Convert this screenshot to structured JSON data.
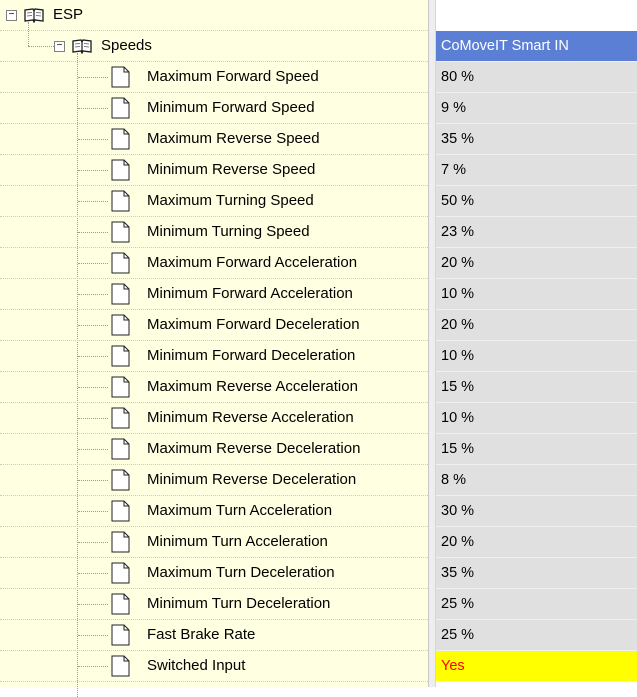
{
  "tree": {
    "root": {
      "label": "ESP",
      "expander": "−",
      "icon": "open-book-icon"
    },
    "group": {
      "label": "Speeds",
      "expander": "−",
      "icon": "open-book-icon"
    },
    "item_icon": "document-page-icon",
    "items": [
      {
        "label": "Maximum Forward Speed",
        "value": "80 %"
      },
      {
        "label": "Minimum Forward Speed",
        "value": "9 %"
      },
      {
        "label": "Maximum Reverse Speed",
        "value": "35 %"
      },
      {
        "label": "Minimum Reverse Speed",
        "value": "7 %"
      },
      {
        "label": "Maximum Turning Speed",
        "value": "50 %"
      },
      {
        "label": "Minimum Turning Speed",
        "value": "23 %"
      },
      {
        "label": "Maximum Forward Acceleration",
        "value": "20 %"
      },
      {
        "label": "Minimum Forward Acceleration",
        "value": "10 %"
      },
      {
        "label": "Maximum Forward Deceleration",
        "value": "20 %"
      },
      {
        "label": "Minimum Forward Deceleration",
        "value": "10 %"
      },
      {
        "label": "Maximum Reverse Acceleration",
        "value": "15 %"
      },
      {
        "label": "Minimum Reverse Acceleration",
        "value": "10 %"
      },
      {
        "label": "Maximum Reverse Deceleration",
        "value": "15 %"
      },
      {
        "label": "Minimum Reverse Deceleration",
        "value": "8 %"
      },
      {
        "label": "Maximum Turn Acceleration",
        "value": "30 %"
      },
      {
        "label": "Minimum Turn Acceleration",
        "value": "20 %"
      },
      {
        "label": "Maximum Turn Deceleration",
        "value": "35 %"
      },
      {
        "label": "Minimum Turn Deceleration",
        "value": "25 %"
      },
      {
        "label": "Fast Brake Rate",
        "value": "25 %"
      },
      {
        "label": "Switched Input",
        "value": "Yes",
        "highlight": true
      }
    ]
  },
  "values": {
    "header": "CoMoveIT Smart IN"
  },
  "colors": {
    "tree_background": "#ffffe1",
    "header_background": "#5c7fd6",
    "value_background": "#e0e0e0",
    "highlight_background": "#ffff00",
    "highlight_text": "#ff0000"
  }
}
